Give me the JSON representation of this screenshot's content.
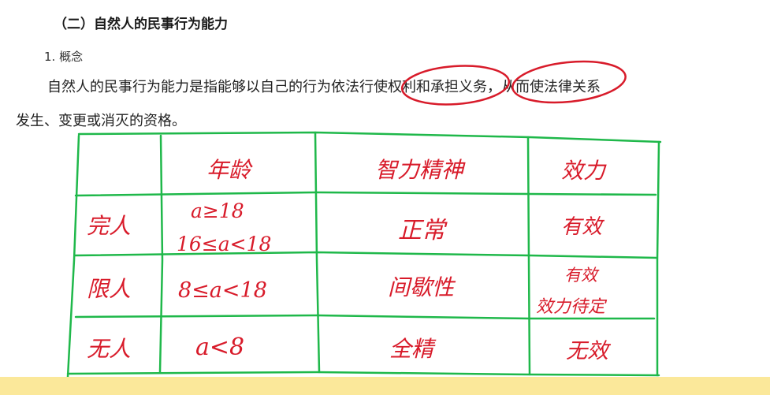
{
  "document": {
    "heading": "（二）自然人的民事行为能力",
    "subheading": "1. 概念",
    "paragraph_line1": "自然人的民事行为能力是指能够以自己的行为依法行使权利和承担义务，从而使法律关系",
    "paragraph_line2": "发生、变更或消灭的资格。"
  },
  "handwritten_table": {
    "headers": [
      "",
      "年龄",
      "智力精神",
      "效力"
    ],
    "rows": [
      {
        "label": "完人",
        "age_line1": "a≥18",
        "age_line2": "16≤a<18",
        "mental": "正常",
        "effect": "有效"
      },
      {
        "label": "限人",
        "age": "8≤a<18",
        "mental": "间歇性",
        "effect_line1": "有效",
        "effect_line2": "效力待定"
      },
      {
        "label": "无人",
        "age": "a<8",
        "mental": "全精",
        "effect": "无效"
      }
    ]
  },
  "colors": {
    "ink_red": "#d81b2a",
    "ink_green": "#1fb84a",
    "band": "#fbe89a"
  }
}
